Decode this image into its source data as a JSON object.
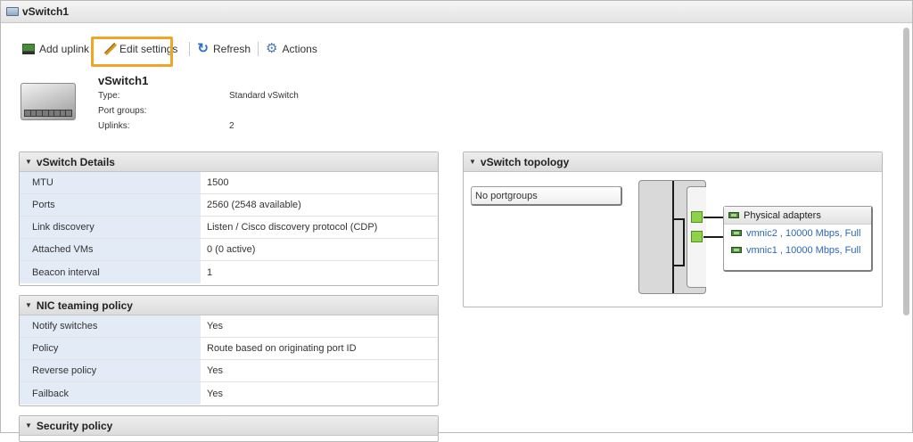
{
  "window": {
    "title": "vSwitch1"
  },
  "toolbar": {
    "add_uplink": "Add uplink",
    "edit_settings": "Edit settings",
    "refresh": "Refresh",
    "actions": "Actions"
  },
  "header": {
    "name": "vSwitch1",
    "rows": [
      {
        "label": "Type:",
        "value": "Standard vSwitch"
      },
      {
        "label": "Port groups:",
        "value": ""
      },
      {
        "label": "Uplinks:",
        "value": "2"
      }
    ]
  },
  "details": {
    "title": "vSwitch Details",
    "rows": [
      {
        "label": "MTU",
        "value": "1500"
      },
      {
        "label": "Ports",
        "value": "2560 (2548 available)"
      },
      {
        "label": "Link discovery",
        "value": "Listen / Cisco discovery protocol (CDP)"
      },
      {
        "label": "Attached VMs",
        "value": "0 (0 active)"
      },
      {
        "label": "Beacon interval",
        "value": "1"
      }
    ]
  },
  "nic_teaming": {
    "title": "NIC teaming policy",
    "rows": [
      {
        "label": "Notify switches",
        "value": "Yes"
      },
      {
        "label": "Policy",
        "value": "Route based on originating port ID"
      },
      {
        "label": "Reverse policy",
        "value": "Yes"
      },
      {
        "label": "Failback",
        "value": "Yes"
      }
    ]
  },
  "security": {
    "title": "Security policy"
  },
  "topology": {
    "title": "vSwitch topology",
    "portgroups_label": "No portgroups",
    "adapters_title": "Physical adapters",
    "adapters": [
      {
        "label": "vmnic2 , 10000 Mbps, Full"
      },
      {
        "label": "vmnic1 , 10000 Mbps, Full"
      }
    ]
  },
  "colors": {
    "highlight": "#f0a526",
    "key_bg": "#e3ecf6",
    "link": "#2b67b5",
    "port_green": "#8fd24a"
  }
}
